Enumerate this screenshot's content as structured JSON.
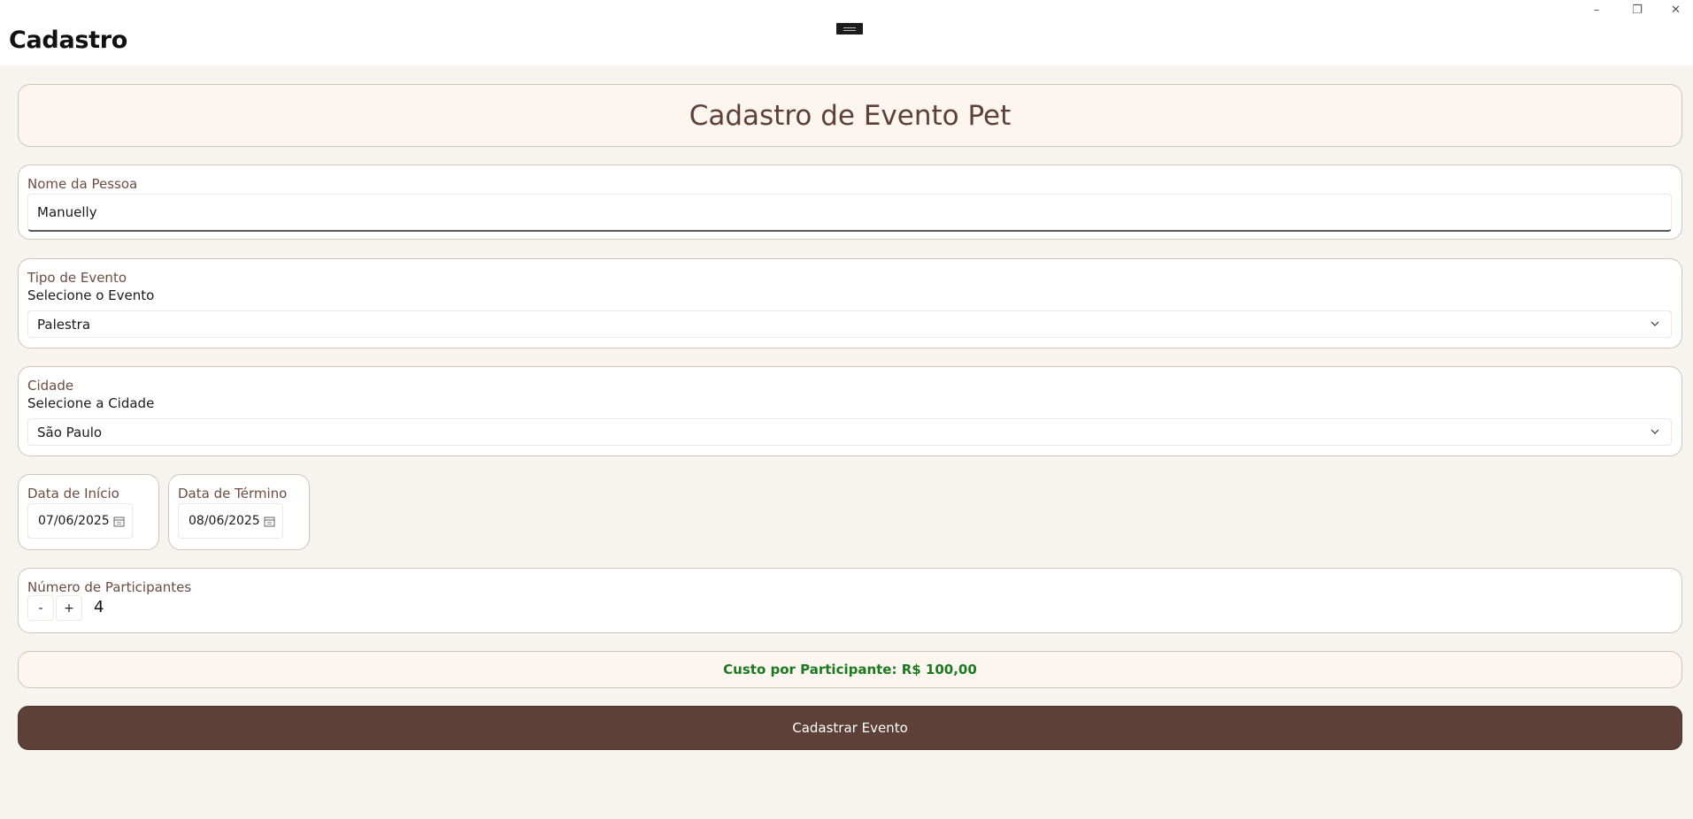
{
  "window": {
    "title": "Cadastro",
    "controls": {
      "minimize": "–",
      "restore": "❐",
      "close": "✕"
    }
  },
  "header": {
    "title": "Cadastro de Evento Pet"
  },
  "person": {
    "label": "Nome da Pessoa",
    "value": "Manuelly"
  },
  "event_type": {
    "label": "Tipo de Evento",
    "sublabel": "Selecione o Evento",
    "selected": "Palestra"
  },
  "city": {
    "label": "Cidade",
    "sublabel": "Selecione a Cidade",
    "selected": "São Paulo"
  },
  "start_date": {
    "label": "Data de Início",
    "value": "07/06/2025"
  },
  "end_date": {
    "label": "Data de Término",
    "value": "08/06/2025"
  },
  "participants": {
    "label": "Número de Participantes",
    "minus": "-",
    "plus": "+",
    "value": "4"
  },
  "cost": {
    "text": "Custo por Participante: R$ 100,00"
  },
  "submit": {
    "label": "Cadastrar Evento"
  },
  "colors": {
    "accent": "#5d4037",
    "label": "#6d4c41",
    "cost": "#1b7a1f",
    "background": "#f7f3ef",
    "header_bg": "#fdf5f0"
  }
}
